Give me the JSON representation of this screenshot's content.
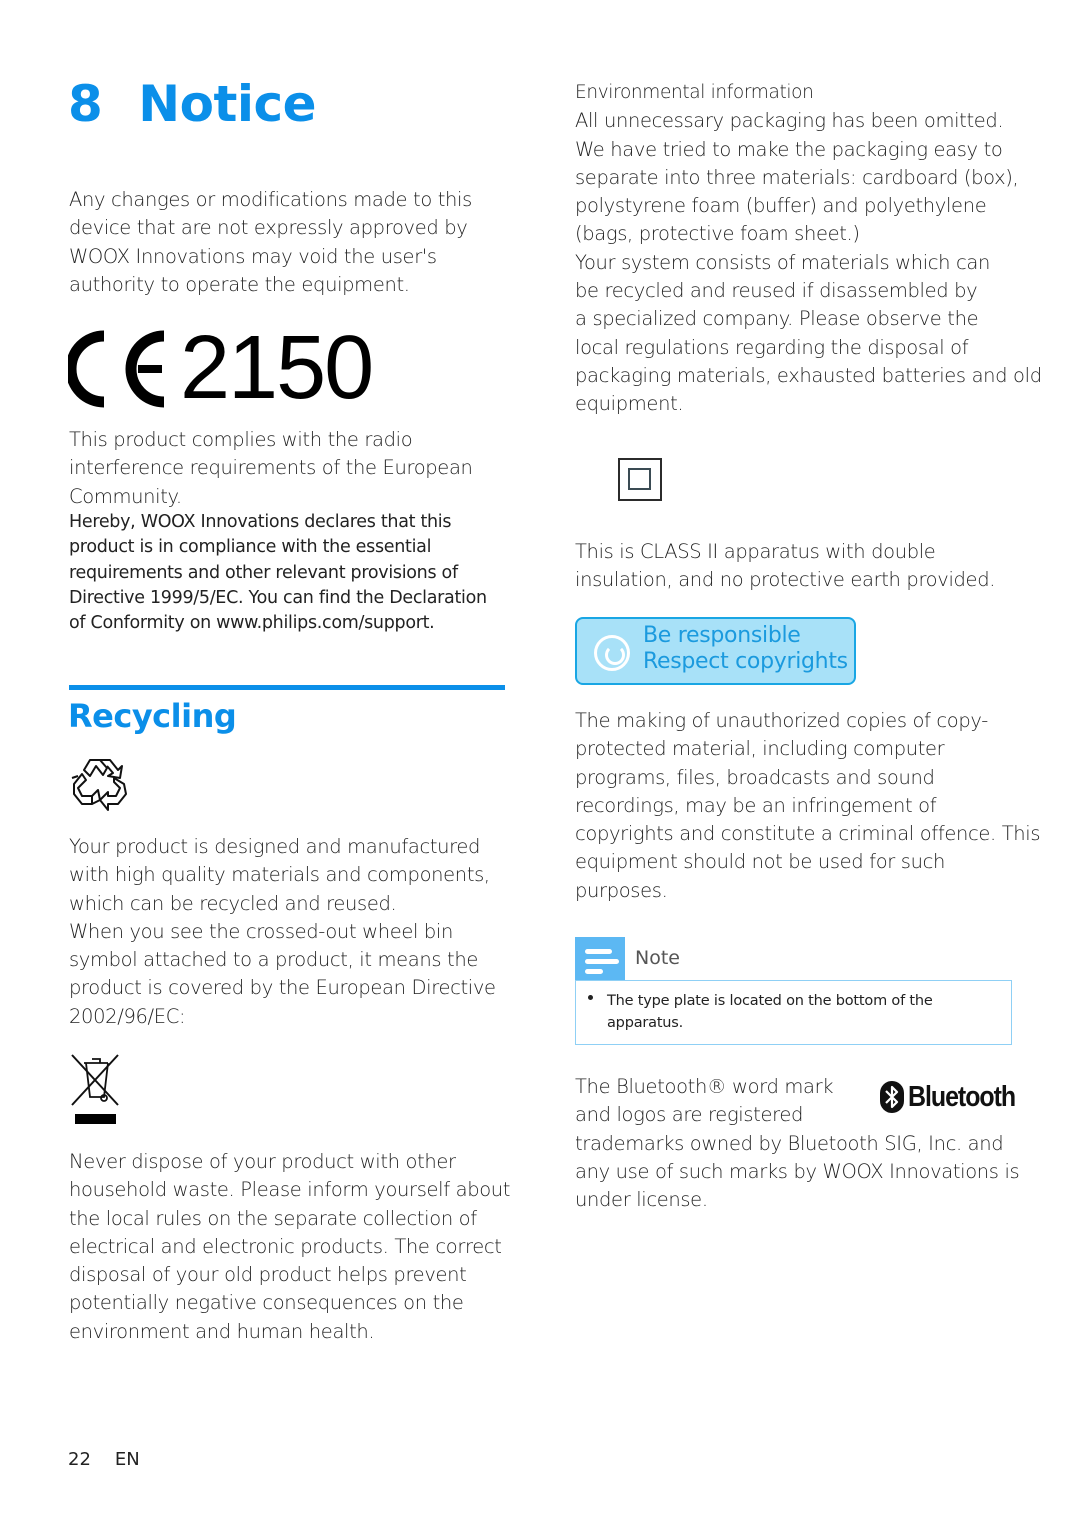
{
  "page": {
    "chapter_number": "8",
    "chapter_title": "Notice",
    "accent_color": "#0b8fe9",
    "footer": {
      "page_number": "22",
      "language": "EN"
    }
  },
  "left_column": {
    "modifications_paragraph": [
      "Any changes or modifications made to this",
      "device that are not expressly approved by",
      "WOOX Innovations may void the user's",
      "authority to operate the equipment."
    ],
    "ce_mark": {
      "icon": "ce-mark-icon",
      "notified_body_number": "2150"
    },
    "compliance_paragraph": [
      "This product complies with the radio",
      "interference requirements of the European",
      "Community."
    ],
    "declaration_paragraph": [
      "Hereby, WOOX Innovations declares that this",
      "product is in compliance with the essential",
      "requirements and other relevant provisions of",
      "Directive 1999/5/EC. You can find the Declaration",
      "of Conformity on www.philips.com/support."
    ],
    "recycling": {
      "heading": "Recycling",
      "recycle_icon": "recycle-icon",
      "paragraph_1": [
        "Your product is designed and manufactured",
        "with high quality materials and components,",
        "which can be recycled and reused.",
        "When you see the crossed-out wheel bin",
        "symbol attached to a product, it means the",
        "product is covered by the European Directive",
        "2002/96/EC:"
      ],
      "weee_icon": "crossed-out-wheelie-bin-icon",
      "paragraph_2": [
        "Never dispose of your product with other",
        "household waste. Please inform yourself about",
        "the local rules on the separate collection of",
        "electrical and electronic products. The correct",
        "disposal of your old product helps prevent",
        "potentially negative consequences on the",
        "environment and human health."
      ]
    }
  },
  "right_column": {
    "environmental": {
      "heading": "Environmental information",
      "paragraph": [
        "All unnecessary packaging has been omitted.",
        "We have tried to make the packaging easy to",
        "separate into three materials: cardboard (box),",
        "polystyrene foam (buffer) and polyethylene",
        "(bags, protective foam sheet.)",
        "Your system consists of materials which can",
        "be recycled and reused if disassembled by",
        "a specialized company. Please observe the",
        "local regulations regarding the disposal of",
        "packaging materials, exhausted batteries and old",
        "equipment."
      ]
    },
    "class_ii": {
      "icon": "class-ii-double-insulation-icon",
      "paragraph": [
        "This is CLASS II apparatus with double",
        "insulation, and no protective earth provided."
      ]
    },
    "copyright_banner": {
      "line_1": "Be responsible",
      "line_2": "Respect copyrights",
      "background_color": "#a8e1f8",
      "text_color": "#1b9ade"
    },
    "copyright_paragraph": [
      "The making of unauthorized copies of copy-",
      "protected material, including computer",
      "programs, files, broadcasts and sound",
      "recordings, may be an infringement of",
      "copyrights and constitute a criminal offence. This",
      "equipment should not be used for such",
      "purposes."
    ],
    "note": {
      "title": "Note",
      "icon": "note-icon",
      "items": [
        [
          "The type plate is located on the bottom of the",
          "apparatus."
        ]
      ]
    },
    "bluetooth": {
      "logo_text": "Bluetooth",
      "paragraph": [
        "The Bluetooth® word mark",
        "and logos are registered",
        "trademarks owned by Bluetooth SIG, Inc. and",
        "any use of such marks by WOOX Innovations is",
        "under license."
      ]
    }
  }
}
